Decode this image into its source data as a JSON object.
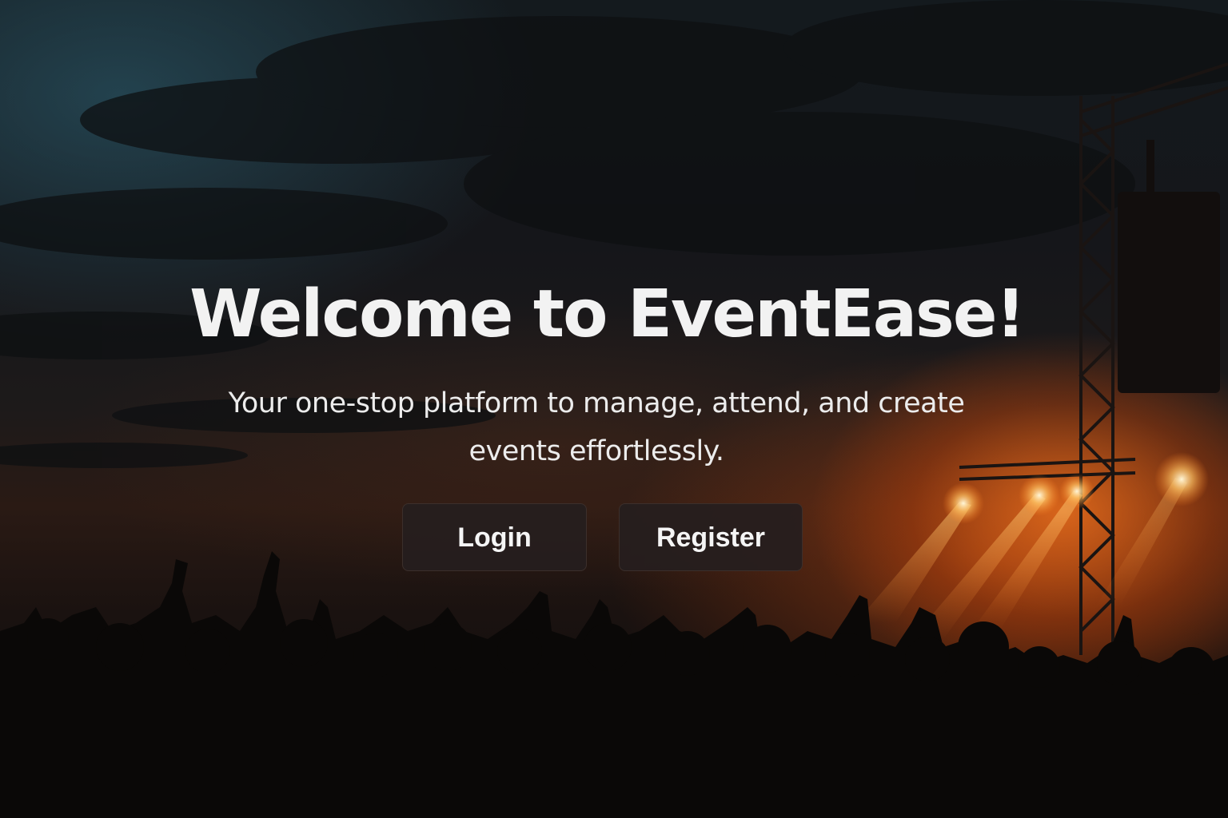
{
  "hero": {
    "title": "Welcome to EventEase!",
    "subtitle_line1": "Your one-stop platform to manage, attend, and create",
    "subtitle_line2": "events effortlessly.",
    "background": "concert-crowd-photo"
  },
  "actions": {
    "login_label": "Login",
    "register_label": "Register"
  },
  "colors": {
    "text": "#f2f2f2",
    "button_bg": "#261e1e",
    "stage_glow": "#ff781e"
  }
}
